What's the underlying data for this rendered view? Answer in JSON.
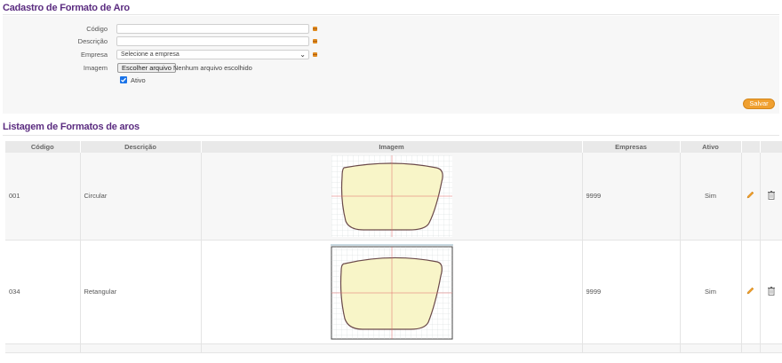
{
  "form": {
    "title": "Cadastro de Formato de Aro",
    "codigo_label": "Código",
    "codigo_value": "",
    "descricao_label": "Descrição",
    "descricao_value": "",
    "empresa_label": "Empresa",
    "empresa_selected": "Selecione a empresa",
    "imagem_label": "Imagem",
    "file_button": "Escolher arquivo",
    "file_status": "Nenhum arquivo escolhido",
    "ativo_label": "Ativo",
    "ativo_checked": true,
    "save_label": "Salvar"
  },
  "listing": {
    "title": "Listagem de Formatos de aros",
    "columns": [
      "Código",
      "Descrição",
      "Imagem",
      "Empresas",
      "Ativo",
      "",
      ""
    ],
    "rows": [
      {
        "codigo": "001",
        "descricao": "Circular",
        "empresas": "9999",
        "ativo": "Sim"
      },
      {
        "codigo": "034",
        "descricao": "Retangular",
        "empresas": "9999",
        "ativo": "Sim"
      }
    ]
  },
  "colors": {
    "title": "#5b2c80",
    "accent": "#f0a030",
    "required": "#e08a1e",
    "checkbox": "#1a73e8",
    "shape_fill": "#f8f5c8",
    "shape_stroke": "#6b4a4a"
  },
  "icons": {
    "edit": "pencil-icon",
    "delete": "trash-icon",
    "required": "required-icon"
  }
}
